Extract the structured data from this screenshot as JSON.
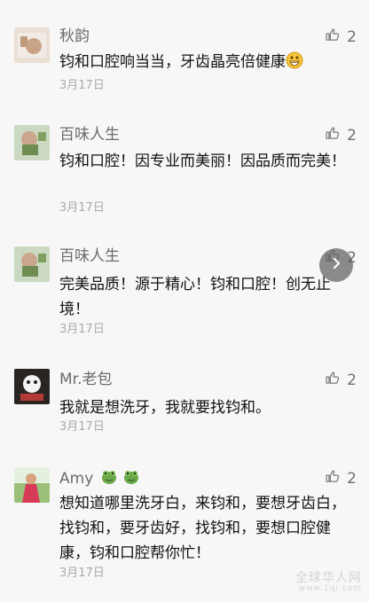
{
  "comments": [
    {
      "nickname": "秋韵",
      "likes": "2",
      "text": "钧和口腔响当当，牙齿晶亮倍健康",
      "emoji": "grin-emoji",
      "date": "3月17日",
      "avatar_color": "#d8c6b8"
    },
    {
      "nickname": "百味人生",
      "likes": "2",
      "text": "钧和口腔！因专业而美丽！因品质而完美！",
      "date": "3月17日",
      "avatar_color": "#8ea46e"
    },
    {
      "nickname": "百味人生",
      "likes": "2",
      "text": "完美品质！源于精心！钧和口腔！创无止境！",
      "date": "3月17日",
      "avatar_color": "#8ea46e"
    },
    {
      "nickname": "Mr.老包",
      "likes": "2",
      "text": "我就是想洗牙，我就要找钧和。",
      "date": "3月17日",
      "avatar_color": "#4a3b30"
    },
    {
      "nickname": "Amy",
      "likes": "2",
      "text": "想知道哪里洗牙白，来钧和，要想牙齿白，找钧和，要牙齿好，找钧和，要想口腔健康，钧和口腔帮你忙！",
      "date": "3月17日",
      "avatar_color": "#b94f5d",
      "nickname_emojis": [
        "green-frog-emoji",
        "green-frog-emoji"
      ]
    }
  ],
  "icons": {
    "like": "thumbs-up-icon",
    "floating": "chevron-right-icon"
  },
  "watermark": {
    "main": "全球华人网",
    "sub": "www.1qi.com"
  }
}
